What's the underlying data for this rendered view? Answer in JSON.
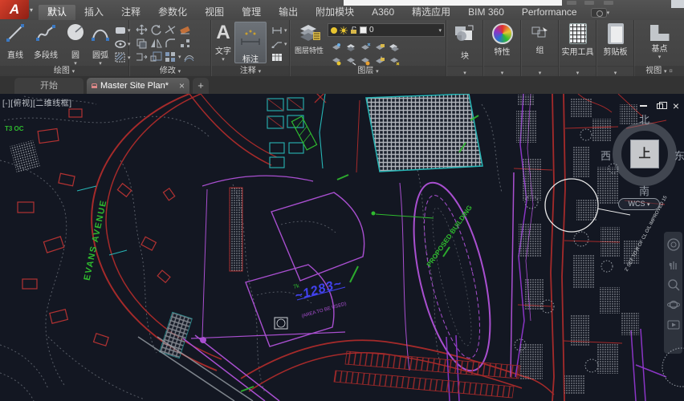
{
  "app": {
    "name": "AutoCAD",
    "logo_letter": "A"
  },
  "ribbon_tabs": {
    "items": [
      "默认",
      "插入",
      "注释",
      "参数化",
      "视图",
      "管理",
      "输出",
      "附加模块",
      "A360",
      "精选应用",
      "BIM 360",
      "Performance"
    ],
    "active": "默认"
  },
  "ribbon": {
    "draw": {
      "title": "绘图",
      "line": "直线",
      "polyline": "多段线",
      "circle": "圆",
      "arc": "圆弧"
    },
    "modify": {
      "title": "修改"
    },
    "annotate": {
      "title": "注释",
      "text": "文字",
      "dimension": "标注"
    },
    "layers": {
      "title": "图层",
      "properties": "图层特性",
      "current_layer": "0"
    },
    "block": {
      "label": "块"
    },
    "properties": {
      "label": "特性"
    },
    "group": {
      "label": "组"
    },
    "utilities": {
      "label": "实用工具"
    },
    "clipboard": {
      "label": "剪贴板"
    },
    "basepoint": {
      "label": "基点"
    },
    "view": {
      "label": "视图"
    }
  },
  "file_tabs": {
    "start": "开始",
    "active": "Master Site Plan*",
    "new_tab": "+"
  },
  "viewport": {
    "label": "[-][俯视][二维线框]",
    "ucs": "WCS",
    "viewcube": {
      "north": "北",
      "south": "南",
      "east": "东",
      "west": "西",
      "top": "上"
    },
    "annotations": {
      "street_name": "EVANS AVENUE",
      "proposed_building": "PROPOSED BUILDING",
      "elevation": "~1283~",
      "grade_note": "7k",
      "area_note": "(AREA TO BE USED)",
      "survey_note": "2' SET TO R OF CL O/L IMPROVED 15",
      "corner_label": "T3 OC"
    },
    "colors": {
      "canvas_bg": "#131722",
      "road_red": "#a52a2a",
      "track_magenta": "#a94fd0",
      "utility_purple": "#8a35c5",
      "building_cyan": "#27b5b5",
      "annotation_green": "#2fbb2f",
      "elevation_blue": "#4242ee",
      "contour_gray": "#8f959e"
    }
  }
}
